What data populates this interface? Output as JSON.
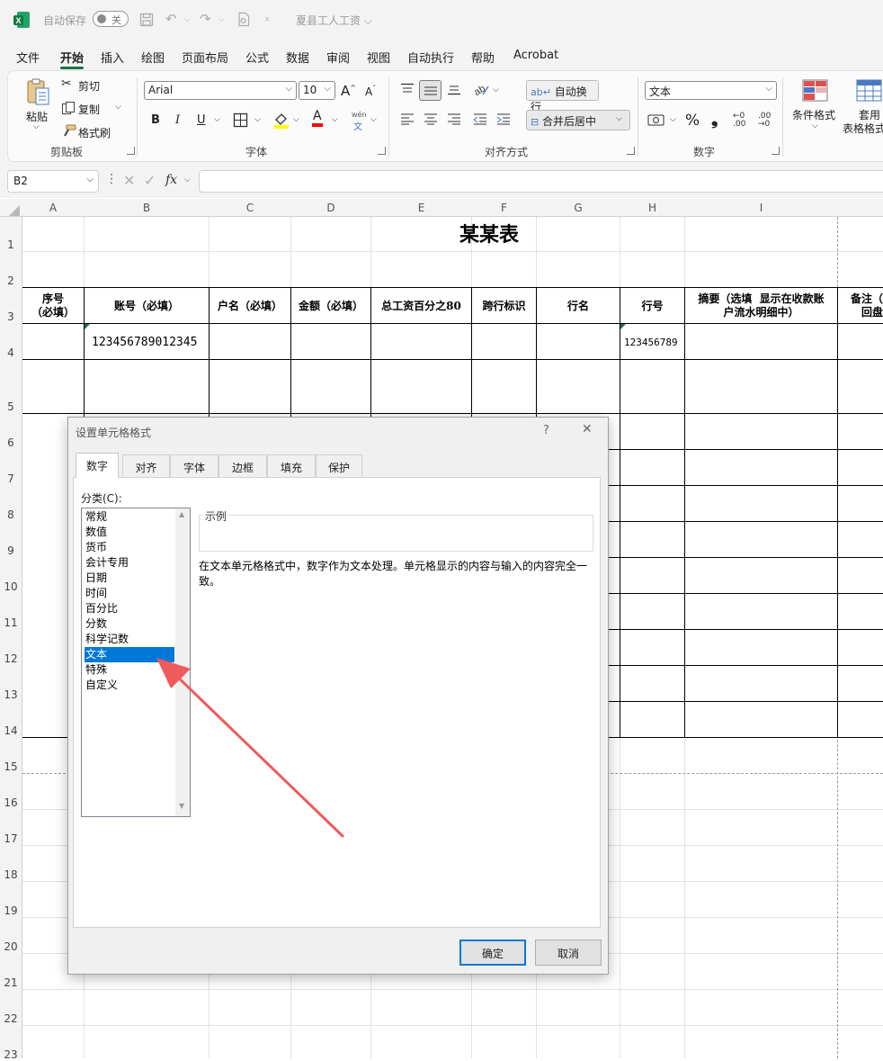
{
  "titlebar": {
    "autosave_label": "自动保存",
    "autosave_state": "关",
    "doc_title": "夏县工人工资",
    "doc_title_caret": "⌵"
  },
  "menu": [
    "文件",
    "开始",
    "插入",
    "绘图",
    "页面布局",
    "公式",
    "数据",
    "审阅",
    "视图",
    "自动执行",
    "帮助",
    "Acrobat"
  ],
  "active_menu": "开始",
  "ribbon": {
    "clipboard": {
      "paste": "粘贴",
      "cut": "剪切",
      "copy": "复制",
      "format_painter": "格式刷",
      "label": "剪贴板"
    },
    "font": {
      "name": "Arial",
      "size": "10",
      "grow": "A",
      "shrink": "A",
      "bold": "B",
      "italic": "I",
      "underline": "U",
      "font_color": "A",
      "wen": "wén",
      "wen2": "文",
      "label": "字体"
    },
    "alignment": {
      "wrap": "自动换行",
      "merge": "合并后居中",
      "label": "对齐方式"
    },
    "number": {
      "format": "文本",
      "percent": "%",
      "comma": "❟",
      "inc_dec": "←0 .00",
      "dec_dec": ".00 →0",
      "label": "数字"
    },
    "styles": {
      "conditional": "条件格式",
      "table_1": "套用",
      "table_2": "表格格式"
    }
  },
  "formula_bar": {
    "name_box": "B2",
    "fx": "fx",
    "content": ""
  },
  "sheet": {
    "columns": [
      "A",
      "B",
      "C",
      "D",
      "E",
      "F",
      "G",
      "H",
      "I"
    ],
    "rows": [
      "1",
      "2",
      "3",
      "4",
      "5",
      "6",
      "7",
      "8",
      "9",
      "10",
      "11",
      "12",
      "13",
      "14",
      "15",
      "16",
      "17",
      "18",
      "19",
      "20",
      "21",
      "22",
      "23"
    ],
    "title": "某某表",
    "headers": {
      "a": "序号\n（必填）",
      "b": "账号（必填）",
      "c": "户名（必填）",
      "d": "金额（必填）",
      "e": "总工资百分之80",
      "f": "跨行标识",
      "g": "行名",
      "h": "行号",
      "i": "摘要（选填  显示在收款账\n户流水明细中）",
      "j": "备注（选\n回盘"
    },
    "account_value": "123456789012345",
    "bank_code_value": "123456789"
  },
  "dialog": {
    "title": "设置单元格格式",
    "help": "?",
    "close": "✕",
    "tabs": [
      "数字",
      "对齐",
      "字体",
      "边框",
      "填充",
      "保护"
    ],
    "active_tab": "数字",
    "category_label": "分类(C):",
    "categories": [
      "常规",
      "数值",
      "货币",
      "会计专用",
      "日期",
      "时间",
      "百分比",
      "分数",
      "科学记数",
      "文本",
      "特殊",
      "自定义"
    ],
    "selected_category": "文本",
    "sample_label": "示例",
    "description": "在文本单元格格式中，数字作为文本处理。单元格显示的内容与输入的内容完全一致。",
    "ok": "确定",
    "cancel": "取消"
  },
  "annotation": {
    "arrow_color": "#ef5a5a"
  },
  "colors": {
    "accent": "#1e7145",
    "selection": "#0078d7"
  }
}
